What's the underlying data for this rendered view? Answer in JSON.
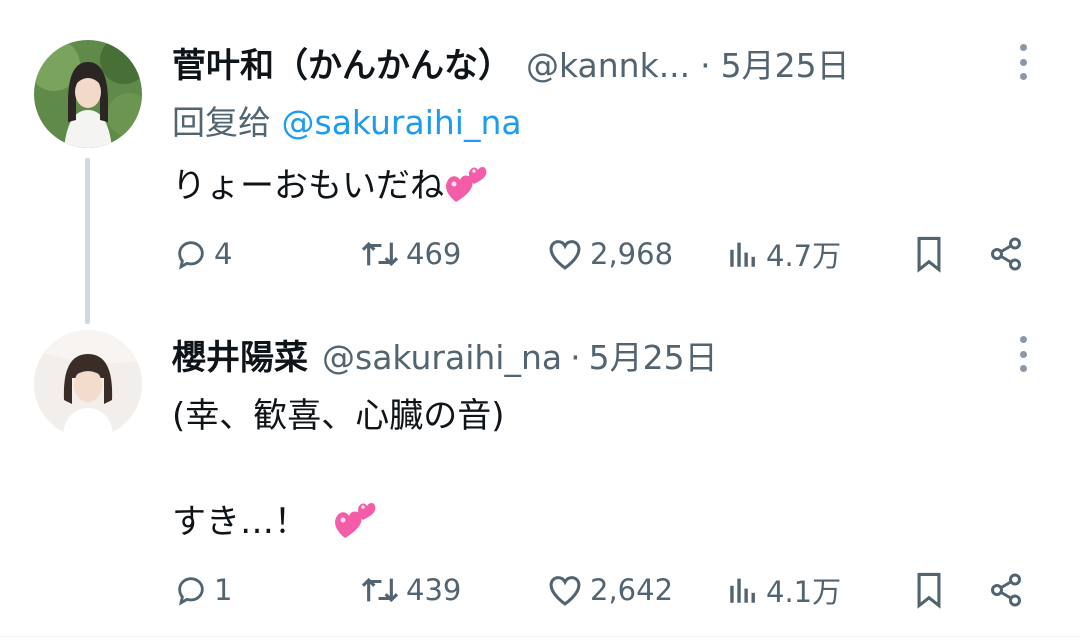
{
  "tweets": [
    {
      "name": "菅叶和（かんかんな）",
      "handle": "@kannk...",
      "separator": "·",
      "date": "5月25日",
      "reply_prefix": "回复给",
      "reply_mention": "@sakuraihi_na",
      "text_lines": [
        "りょーおもいだね"
      ],
      "emoji": "two-hearts-icon",
      "replies": "4",
      "retweets": "469",
      "likes": "2,968",
      "views": "4.7万"
    },
    {
      "name": "櫻井陽菜",
      "handle": "@sakuraihi_na",
      "separator": "·",
      "date": "5月25日",
      "text_lines": [
        "(幸、歓喜、心臓の音)",
        "すき…！"
      ],
      "emoji": "two-hearts-icon",
      "replies": "1",
      "retweets": "439",
      "likes": "2,642",
      "views": "4.1万"
    }
  ],
  "colors": {
    "text_primary": "#0f1419",
    "text_secondary": "#536471",
    "mention": "#1d9bf0",
    "emoji_pink": "#f25ca8",
    "thread_line": "#cfd9de"
  }
}
